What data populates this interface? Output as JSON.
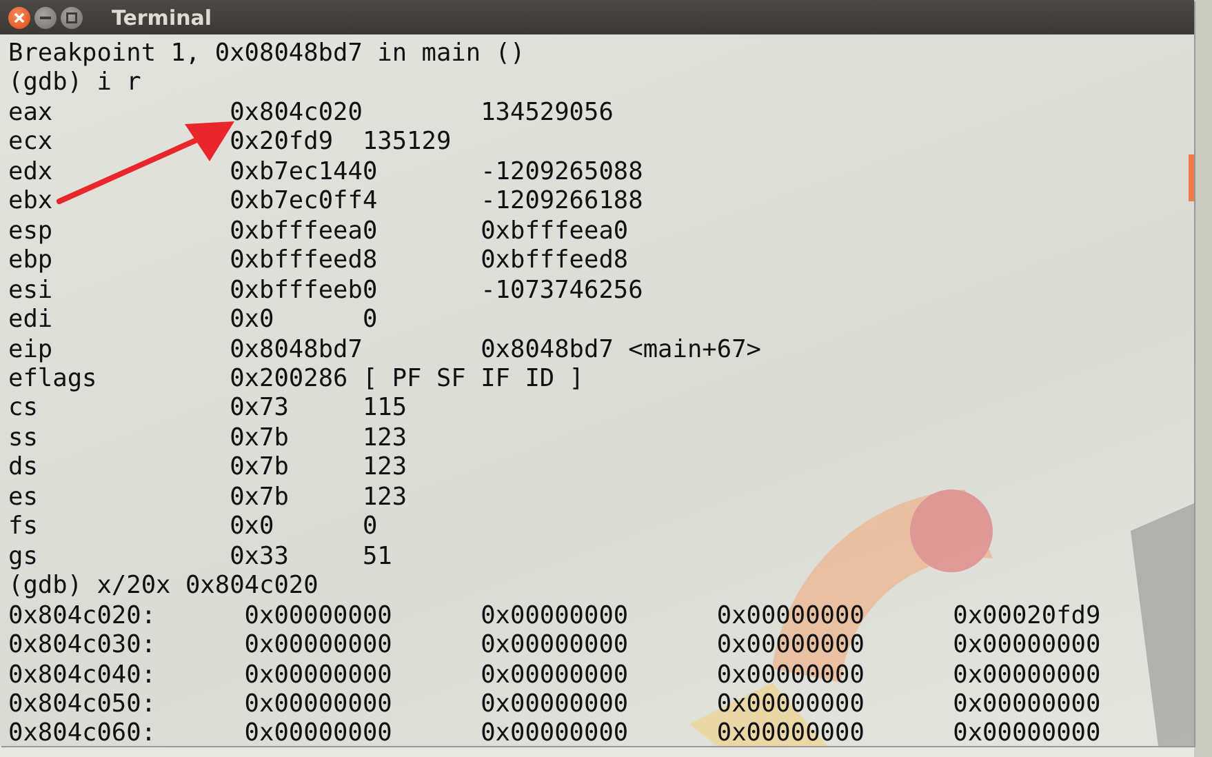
{
  "window": {
    "title": "Terminal"
  },
  "output_lines": [
    "Breakpoint 1, 0x08048bd7 in main ()",
    "(gdb) i r"
  ],
  "registers": [
    {
      "name": "eax",
      "value": "0x804c020",
      "natural": "134529056"
    },
    {
      "name": "ecx",
      "value": "0x20fd9",
      "natural": "135129"
    },
    {
      "name": "edx",
      "value": "0xb7ec1440",
      "natural": "-1209265088"
    },
    {
      "name": "ebx",
      "value": "0xb7ec0ff4",
      "natural": "-1209266188"
    },
    {
      "name": "esp",
      "value": "0xbfffeea0",
      "natural": "0xbfffeea0"
    },
    {
      "name": "ebp",
      "value": "0xbfffeed8",
      "natural": "0xbfffeed8"
    },
    {
      "name": "esi",
      "value": "0xbfffeeb0",
      "natural": "-1073746256"
    },
    {
      "name": "edi",
      "value": "0x0",
      "natural": "0"
    },
    {
      "name": "eip",
      "value": "0x8048bd7",
      "natural": "0x8048bd7 <main+67>"
    },
    {
      "name": "eflags",
      "value": "0x200286",
      "natural": "[ PF SF IF ID ]"
    },
    {
      "name": "cs",
      "value": "0x73",
      "natural": "115"
    },
    {
      "name": "ss",
      "value": "0x7b",
      "natural": "123"
    },
    {
      "name": "ds",
      "value": "0x7b",
      "natural": "123"
    },
    {
      "name": "es",
      "value": "0x7b",
      "natural": "123"
    },
    {
      "name": "fs",
      "value": "0x0",
      "natural": "0"
    },
    {
      "name": "gs",
      "value": "0x33",
      "natural": "51"
    }
  ],
  "command": "(gdb) x/20x 0x804c020",
  "memory": [
    {
      "address": "0x804c020:",
      "words": [
        "0x00000000",
        "0x00000000",
        "0x00000000",
        "0x00020fd9"
      ]
    },
    {
      "address": "0x804c030:",
      "words": [
        "0x00000000",
        "0x00000000",
        "0x00000000",
        "0x00000000"
      ]
    },
    {
      "address": "0x804c040:",
      "words": [
        "0x00000000",
        "0x00000000",
        "0x00000000",
        "0x00000000"
      ]
    },
    {
      "address": "0x804c050:",
      "words": [
        "0x00000000",
        "0x00000000",
        "0x00000000",
        "0x00000000"
      ]
    },
    {
      "address": "0x804c060:",
      "words": [
        "0x00000000",
        "0x00000000",
        "0x00000000",
        "0x00000000"
      ]
    }
  ]
}
